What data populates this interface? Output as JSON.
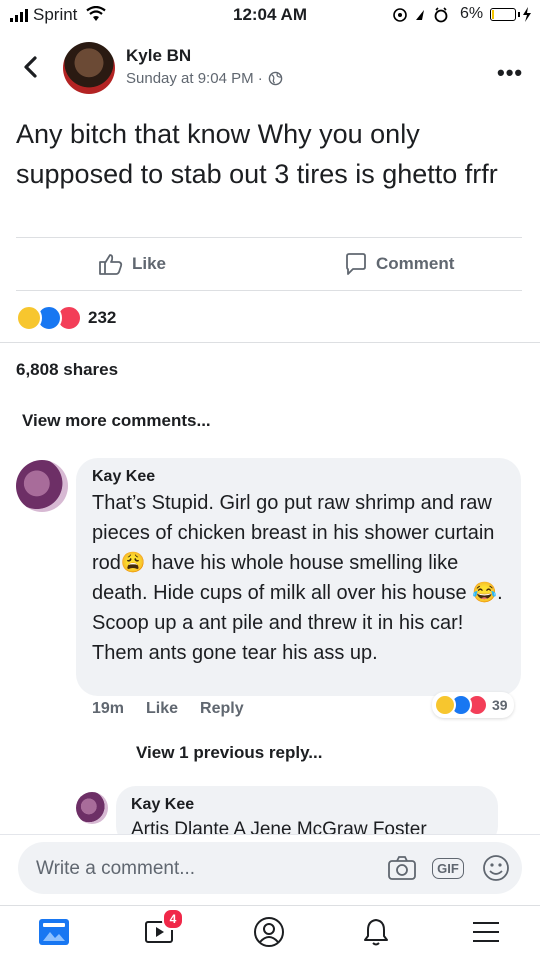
{
  "status_bar": {
    "carrier": "Sprint",
    "time": "12:04 AM",
    "battery": "6%"
  },
  "header": {
    "author": "Kyle BN",
    "timestamp": "Sunday at 9:04 PM ·"
  },
  "post": {
    "text": "Any bitch that know Why you only supposed to stab out 3 tires is ghetto frfr",
    "like_label": "Like",
    "comment_label": "Comment",
    "reaction_count": "232",
    "shares": "6,808 shares"
  },
  "comments": {
    "view_more": "View more comments...",
    "items": [
      {
        "author": "Kay Kee",
        "text_parts": [
          "That’s Stupid. Girl go put raw shrimp and raw pieces of chicken breast in his shower curtain rod",
          " have his whole house smelling like death. Hide cups of milk all over his house",
          ". Scoop up a ant pile and threw it in his car! Them ants gone tear his ass up."
        ],
        "time": "19m",
        "like_label": "Like",
        "reply_label": "Reply",
        "reaction_count": "39"
      }
    ],
    "view_replies": "View 1 previous reply...",
    "reply": {
      "author": "Kay Kee",
      "text": "Artis Dlante A Jene McGraw Foster"
    }
  },
  "composer": {
    "placeholder": "Write a comment...",
    "gif_label": "GIF"
  },
  "tabbar": {
    "video_badge": "4"
  },
  "colors": {
    "accent": "#1877f2",
    "badge": "#f02849",
    "muted": "#606770",
    "bubble": "#f0f2f5"
  }
}
